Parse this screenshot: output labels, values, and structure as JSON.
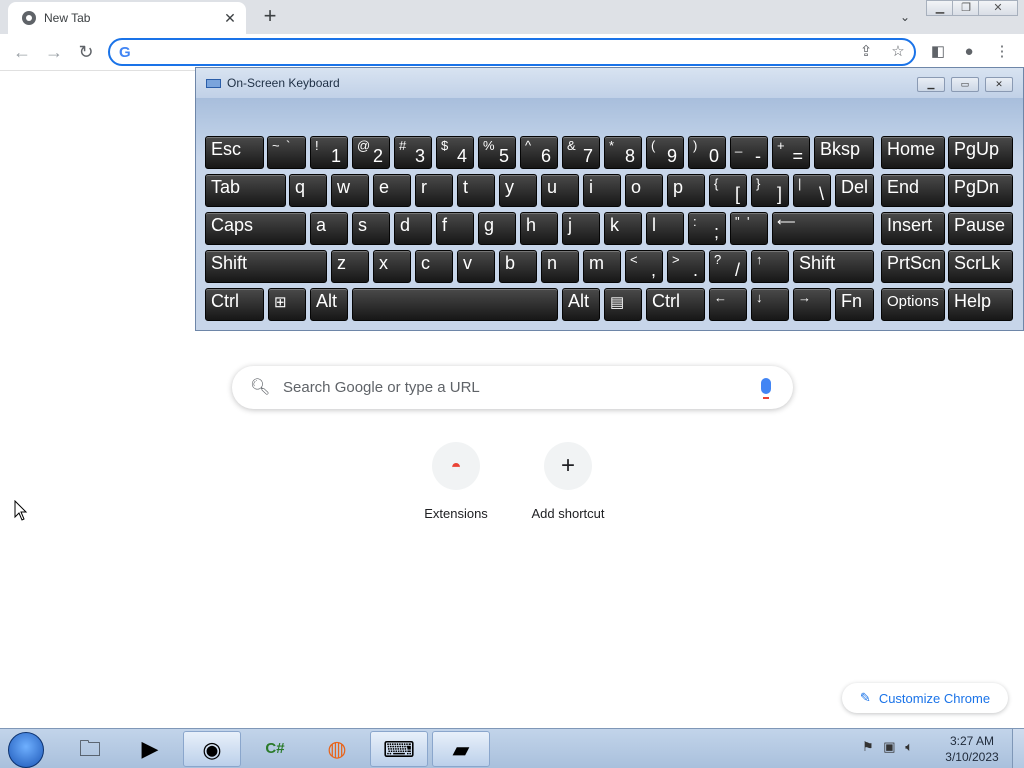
{
  "browser": {
    "tab_title": "New Tab",
    "tab_close": "✕",
    "new_tab": "+",
    "tab_search": "⌄",
    "window_controls": {
      "minimize": "▁",
      "restore": "❐",
      "close": "✕"
    },
    "nav": {
      "back": "←",
      "forward": "→",
      "reload": "↻"
    },
    "omnibox_value": "",
    "omnibox_logo": "G"
  },
  "osk": {
    "title": "On-Screen Keyboard",
    "controls": {
      "minimize": "▁",
      "restore": "▭",
      "close": "✕"
    },
    "keys": {
      "esc": "Esc",
      "tilde_s": "~",
      "tilde_b": "`",
      "k1_s": "!",
      "k1": "1",
      "k2_s": "@",
      "k2": "2",
      "k3_s": "#",
      "k3": "3",
      "k4_s": "$",
      "k4": "4",
      "k5_s": "%",
      "k5": "5",
      "k6_s": "^",
      "k6": "6",
      "k7_s": "&",
      "k7": "7",
      "k8_s": "*",
      "k8": "8",
      "k9_s": "(",
      "k9": "9",
      "k0_s": ")",
      "k0": "0",
      "minus_s": "_",
      "minus": "-",
      "eq_s": "+",
      "eq": "=",
      "bksp": "Bksp",
      "home": "Home",
      "pgup": "PgUp",
      "tab": "Tab",
      "q": "q",
      "w": "w",
      "e": "e",
      "r": "r",
      "t": "t",
      "y": "y",
      "u": "u",
      "i": "i",
      "o": "o",
      "p": "p",
      "lb_s": "{",
      "lb": "[",
      "rb_s": "}",
      "rb": "]",
      "bs_s": "|",
      "bs": "\\",
      "del": "Del",
      "end": "End",
      "pgdn": "PgDn",
      "caps": "Caps",
      "a": "a",
      "s": "s",
      "d": "d",
      "f": "f",
      "g": "g",
      "h": "h",
      "j": "j",
      "k": "k",
      "l": "l",
      "semi_s": ":",
      "semi": ";",
      "quote_s": "\"",
      "quote": "'",
      "enter": "⟵",
      "insert": "Insert",
      "pause": "Pause",
      "shift": "Shift",
      "z": "z",
      "x": "x",
      "c": "c",
      "v": "v",
      "b": "b",
      "n": "n",
      "m": "m",
      "comma_s": "<",
      "comma": ",",
      "dot_s": ">",
      "dot": ".",
      "slash_s": "?",
      "slash": "/",
      "up": "↑",
      "shift_r": "Shift",
      "prtscn": "PrtScn",
      "scrlk": "ScrLk",
      "ctrl": "Ctrl",
      "win": "⊞",
      "alt": "Alt",
      "alt_r": "Alt",
      "menu": "▤",
      "ctrl_r": "Ctrl",
      "left": "←",
      "down": "↓",
      "right": "→",
      "fn": "Fn",
      "options": "Options",
      "help": "Help"
    }
  },
  "newtab": {
    "search_placeholder": "Search Google or type a URL",
    "shortcuts": [
      {
        "label": "Extensions",
        "icon": "◓"
      },
      {
        "label": "Add shortcut",
        "icon": "+"
      }
    ],
    "customize_label": "Customize Chrome"
  },
  "taskbar": {
    "time": "3:27 AM",
    "date": "3/10/2023"
  }
}
